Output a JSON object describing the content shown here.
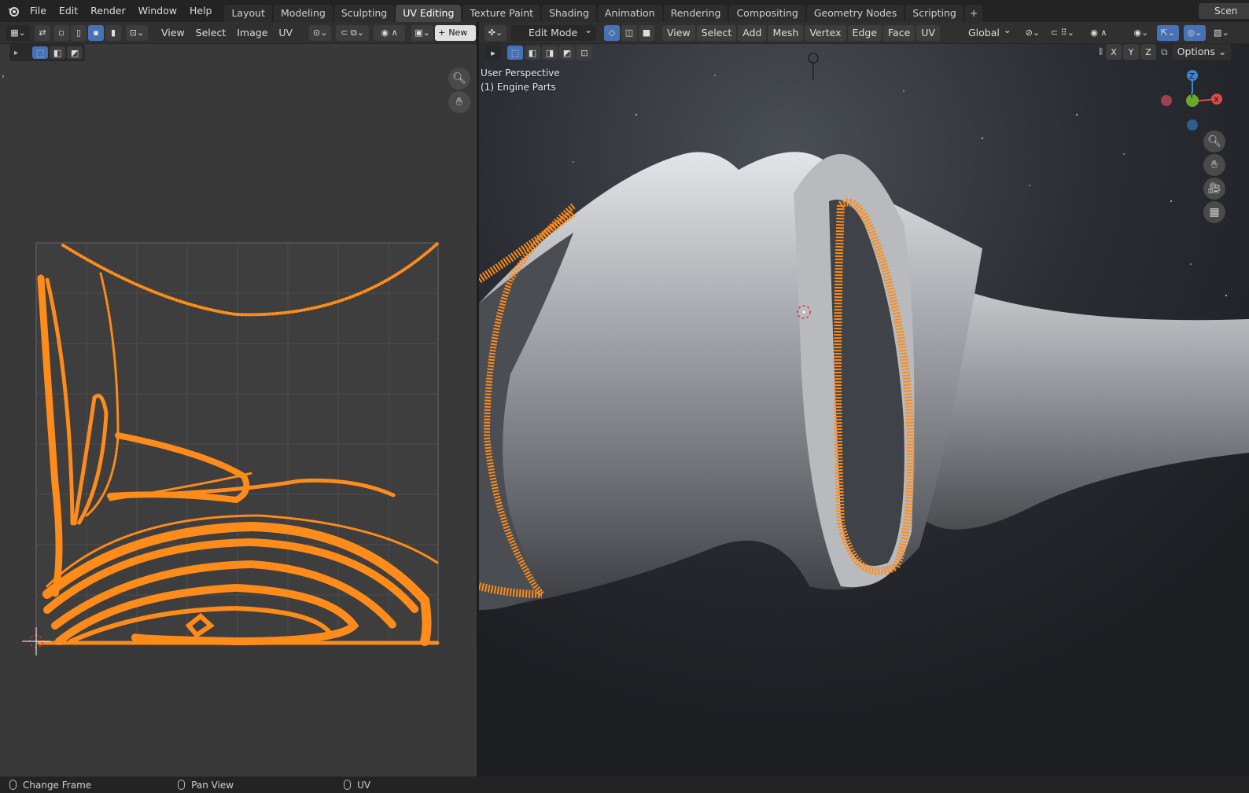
{
  "topbar": {
    "menus": [
      "File",
      "Edit",
      "Render",
      "Window",
      "Help"
    ],
    "workspaces": [
      "Layout",
      "Modeling",
      "Sculpting",
      "UV Editing",
      "Texture Paint",
      "Shading",
      "Animation",
      "Rendering",
      "Compositing",
      "Geometry Nodes",
      "Scripting"
    ],
    "active_workspace": "UV Editing",
    "scene_label": "Scen"
  },
  "uv_editor": {
    "menus": [
      "View",
      "Select",
      "Image",
      "UV"
    ],
    "new_label": "New"
  },
  "viewport": {
    "mode_label": "Edit Mode",
    "menus": [
      "View",
      "Select",
      "Add",
      "Mesh",
      "Vertex",
      "Edge",
      "Face",
      "UV"
    ],
    "orientation_label": "Global",
    "axis_buttons": [
      "X",
      "Y",
      "Z"
    ],
    "options_label": "Options",
    "perspective_label": "User Perspective",
    "object_label": "(1) Engine Parts",
    "gizmo": {
      "z": "Z",
      "y": "Y",
      "x": "X"
    }
  },
  "statusbar": {
    "items": [
      "Change Frame",
      "Pan View",
      "UV"
    ]
  },
  "colors": {
    "accent": "#4772b3",
    "selection": "#ff8c1a",
    "header_bg": "#303030",
    "topbar_bg": "#232323"
  }
}
